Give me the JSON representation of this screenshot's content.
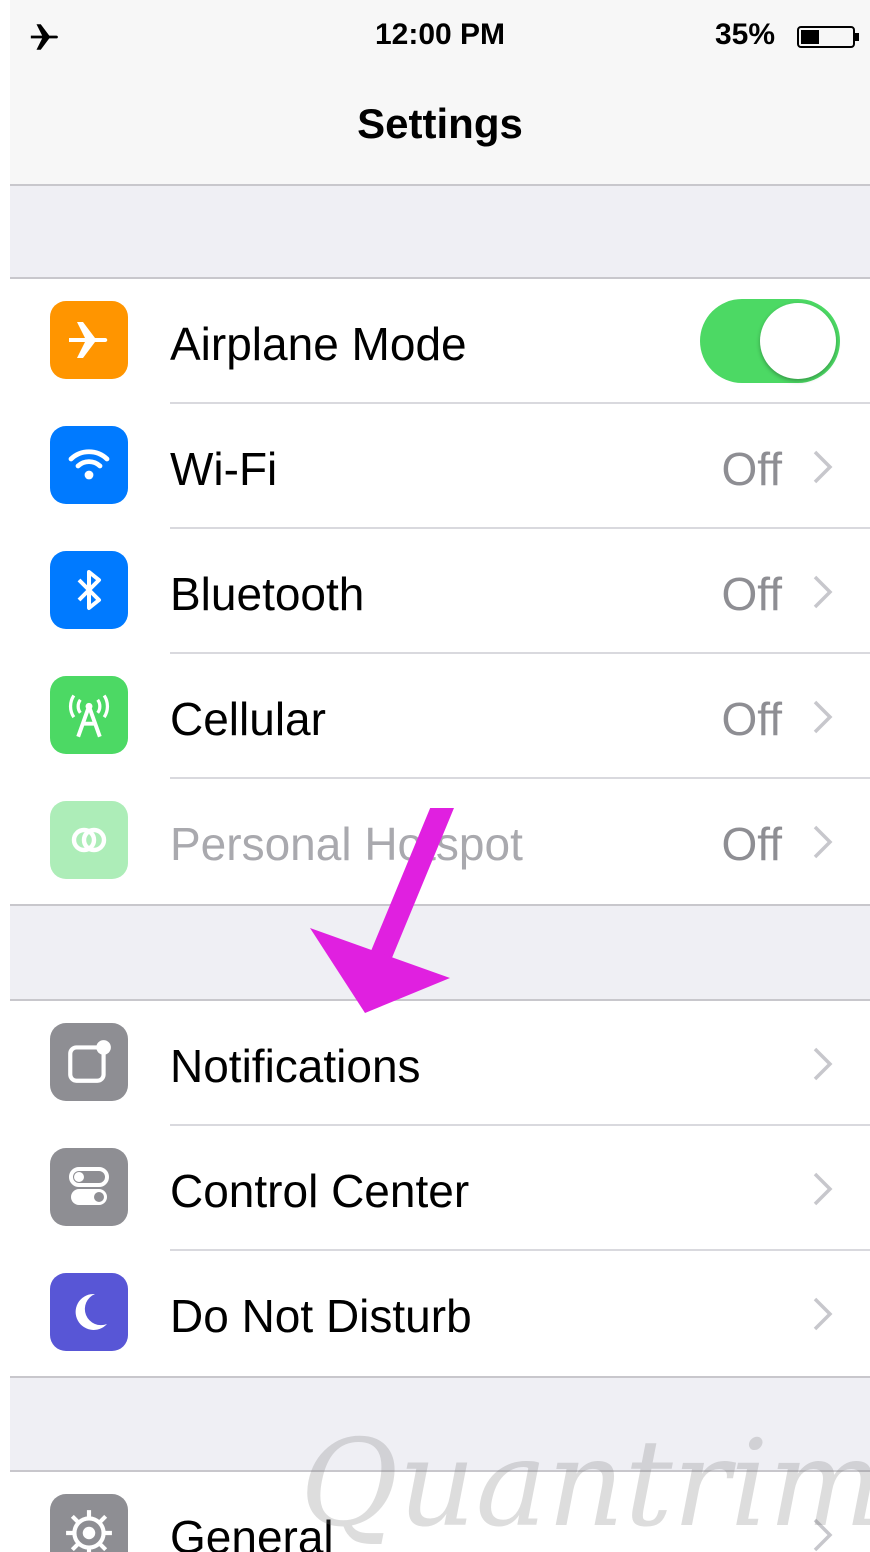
{
  "status_bar": {
    "time": "12:00 PM",
    "battery_percent": "35%",
    "airplane_icon": "airplane-icon",
    "battery_level": 0.35
  },
  "nav": {
    "title": "Settings"
  },
  "groups": [
    {
      "rows": [
        {
          "label": "Airplane Mode",
          "icon": "airplane-icon",
          "icon_color": "#ff9500",
          "toggle_on": true
        },
        {
          "label": "Wi-Fi",
          "value": "Off",
          "icon": "wifi-icon",
          "icon_color": "#007aff"
        },
        {
          "label": "Bluetooth",
          "value": "Off",
          "icon": "bluetooth-icon",
          "icon_color": "#007aff"
        },
        {
          "label": "Cellular",
          "value": "Off",
          "icon": "cellular-icon",
          "icon_color": "#4cd964"
        },
        {
          "label": "Personal Hotspot",
          "value": "Off",
          "icon": "hotspot-icon",
          "icon_color": "#4cd964",
          "disabled": true
        }
      ]
    },
    {
      "rows": [
        {
          "label": "Notifications",
          "icon": "notifications-icon",
          "icon_color": "#8e8e93"
        },
        {
          "label": "Control Center",
          "icon": "control-center-icon",
          "icon_color": "#8e8e93"
        },
        {
          "label": "Do Not Disturb",
          "icon": "moon-icon",
          "icon_color": "#5856d6"
        }
      ]
    },
    {
      "rows": [
        {
          "label": "General",
          "icon": "gear-icon",
          "icon_color": "#8e8e93"
        }
      ]
    }
  ],
  "annotation": {
    "arrow_color": "#e020e0"
  },
  "watermark": {
    "text": "Quantrimang"
  }
}
